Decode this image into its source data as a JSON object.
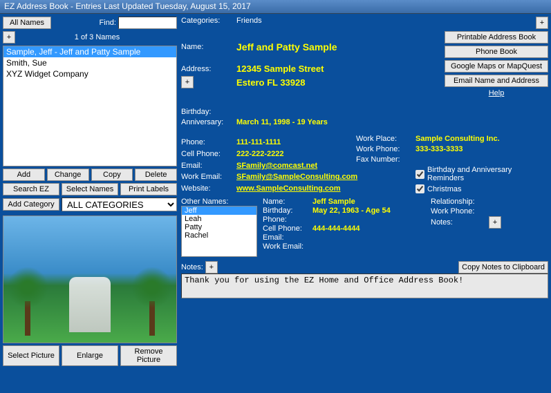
{
  "title": "EZ Address Book - Entries Last Updated Tuesday, August 15, 2017",
  "left": {
    "all_names": "All Names",
    "find": "Find:",
    "count": "1 of 3 Names",
    "names": [
      "Sample, Jeff - Jeff and Patty Sample",
      "Smith, Sue",
      "XYZ Widget Company"
    ],
    "add": "Add",
    "change": "Change",
    "copy": "Copy",
    "delete": "Delete",
    "search": "Search EZ",
    "select_names": "Select Names",
    "print_labels": "Print Labels",
    "add_category": "Add Category",
    "category_filter": "ALL CATEGORIES",
    "select_picture": "Select Picture",
    "enlarge": "Enlarge",
    "remove_picture": "Remove Picture"
  },
  "labels": {
    "categories": "Categories:",
    "name": "Name:",
    "address": "Address:",
    "birthday": "Birthday:",
    "anniversary": "Anniversary:",
    "phone": "Phone:",
    "cell": "Cell Phone:",
    "email": "Email:",
    "work_email": "Work Email:",
    "website": "Website:",
    "work_place": "Work Place:",
    "work_phone": "Work Phone:",
    "fax": "Fax Number:",
    "other_names": "Other Names:",
    "relationship": "Relationship:",
    "notes": "Notes:"
  },
  "entry": {
    "categories": "Friends",
    "name": "Jeff and Patty Sample",
    "addr1": "12345 Sample Street",
    "addr2": "Estero FL  33928",
    "anniversary": "March 11, 1998   -   19 Years",
    "phone": "111-111-1111",
    "cell": "222-222-2222",
    "email": "SFamily@comcast.net",
    "work_email": "SFamily@SampleConsulting.com",
    "website": "www.SampleConsulting.com",
    "work_place": "Sample Consulting Inc.",
    "work_phone": "333-333-3333"
  },
  "other": {
    "names": [
      "Jeff",
      "Leah",
      "Patty",
      "Rachel"
    ],
    "sub": {
      "name_lbl": "Name:",
      "name": "Jeff Sample",
      "bday_lbl": "Birthday:",
      "bday": "May 22, 1963 - Age 54",
      "phone_lbl": "Phone:",
      "cell_lbl": "Cell Phone:",
      "cell": "444-444-4444",
      "email_lbl": "Email:",
      "workemail_lbl": "Work Email:",
      "workphone_lbl": "Work Phone:",
      "notes_lbl": "Notes:"
    }
  },
  "rightbtns": {
    "printable": "Printable Address Book",
    "phonebook": "Phone Book",
    "maps": "Google Maps or MapQuest",
    "emailname": "Email Name and Address",
    "help": "Help"
  },
  "checks": {
    "reminders": "Birthday and Anniversary Reminders",
    "christmas": "Christmas"
  },
  "notesbar": {
    "notes": "Notes:",
    "copy": "Copy Notes to Clipboard"
  },
  "notes_text": "Thank you for using the EZ Home and Office Address Book!",
  "plus": "+"
}
